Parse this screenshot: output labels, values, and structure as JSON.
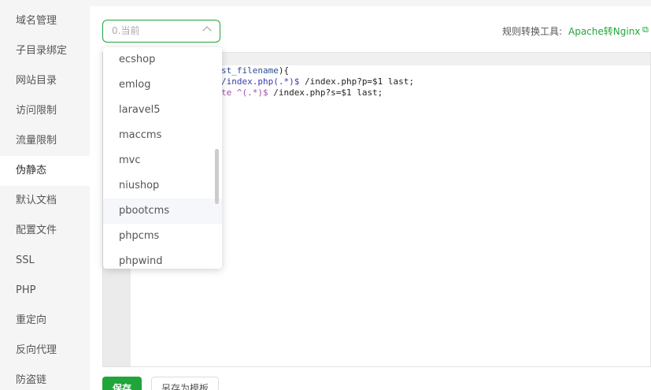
{
  "sidebar": {
    "items": [
      {
        "label": "域名管理"
      },
      {
        "label": "子目录绑定"
      },
      {
        "label": "网站目录"
      },
      {
        "label": "访问限制"
      },
      {
        "label": "流量限制"
      },
      {
        "label": "伪静态",
        "active": true
      },
      {
        "label": "默认文档"
      },
      {
        "label": "配置文件"
      },
      {
        "label": "SSL"
      },
      {
        "label": "PHP"
      },
      {
        "label": "重定向"
      },
      {
        "label": "反向代理"
      },
      {
        "label": "防盗链"
      }
    ]
  },
  "rewrite_select": {
    "value": "0.当前",
    "options": [
      "ecshop",
      "emlog",
      "laravel5",
      "maccms",
      "mvc",
      "niushop",
      "pbootcms",
      "phpcms",
      "phpwind"
    ],
    "hovered": "pbootcms"
  },
  "tool": {
    "label": "规则转换工具:",
    "link": "Apache转Nginx",
    "icon": "external-link-icon"
  },
  "editor": {
    "lines": [
      {
        "a": "",
        "b": "st_filename",
        "c": "){"
      },
      {
        "a": "",
        "b": "/index.php(.*)$",
        "c": " /index.php?p=$1 last;"
      },
      {
        "a": "",
        "b": "te ^(.*)$",
        "c": " /index.php?s=$1 last;"
      }
    ]
  },
  "actions": {
    "save_label": "保存",
    "save_as_template_label": "另存为模板"
  },
  "colors": {
    "accent": "#20a53a"
  }
}
